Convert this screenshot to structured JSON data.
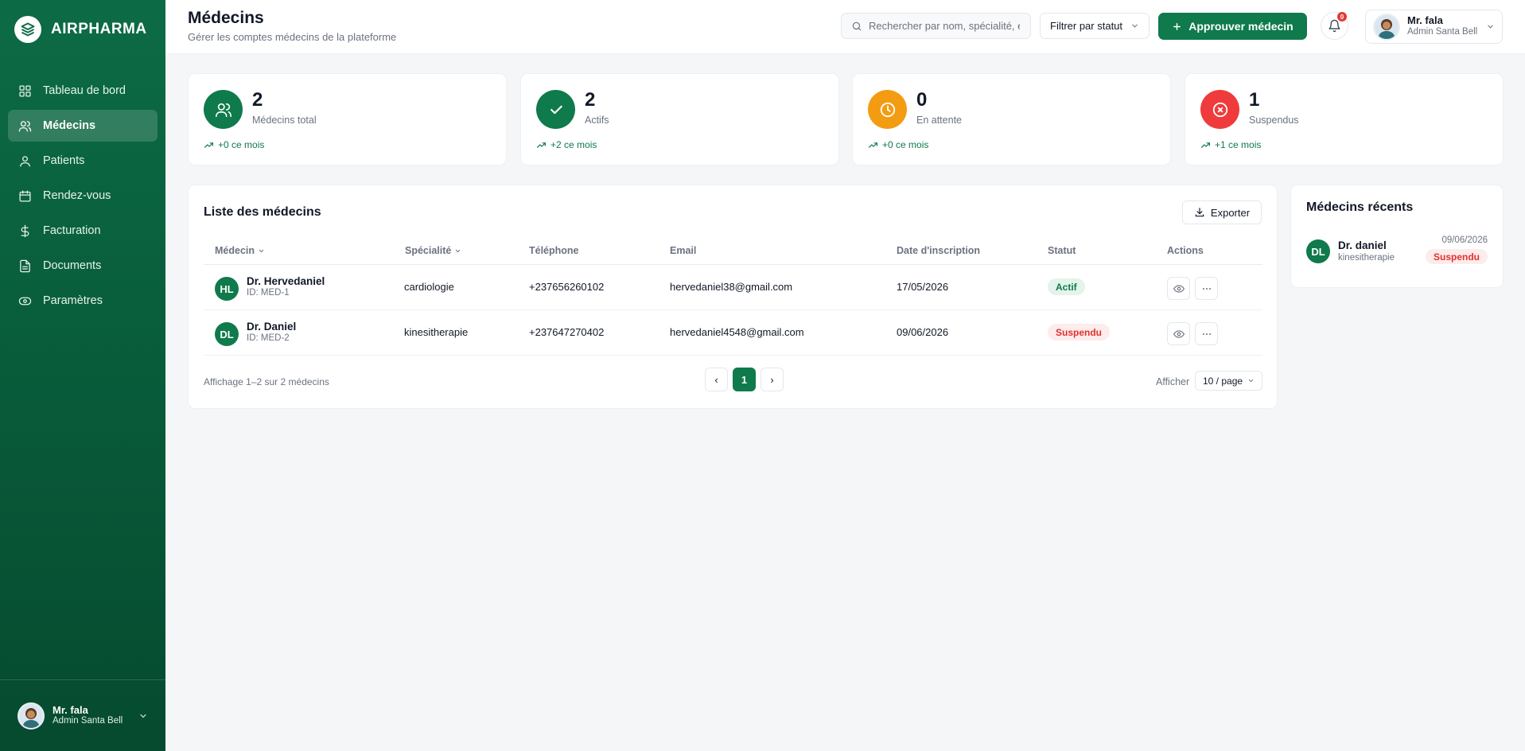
{
  "brand": {
    "name": "AIRPHARMA"
  },
  "sidebar": {
    "items": [
      {
        "label": "Tableau de bord",
        "icon": "grid-icon"
      },
      {
        "label": "Médecins",
        "icon": "users-icon",
        "active": true
      },
      {
        "label": "Patients",
        "icon": "user-icon"
      },
      {
        "label": "Rendez-vous",
        "icon": "calendar-icon"
      },
      {
        "label": "Facturation",
        "icon": "dollar-icon"
      },
      {
        "label": "Documents",
        "icon": "document-icon"
      },
      {
        "label": "Paramètres",
        "icon": "settings-icon"
      }
    ],
    "user": {
      "name": "Mr. fala",
      "role": "Admin Santa Bell"
    }
  },
  "header": {
    "title": "Médecins",
    "subtitle": "Gérer les comptes médecins de la plateforme",
    "search_placeholder": "Rechercher par nom, spécialité, email...",
    "filter_label": "Filtrer par statut",
    "approve_label": "Approuver médecin",
    "notifications_count": "0",
    "user": {
      "name": "Mr. fala",
      "role": "Admin Santa Bell"
    }
  },
  "stats": [
    {
      "value": "2",
      "label": "Médecins total",
      "trend": "+0 ce mois",
      "color": "#0f7a4b",
      "icon": "users-icon"
    },
    {
      "value": "2",
      "label": "Actifs",
      "trend": "+2 ce mois",
      "color": "#0f7a4b",
      "icon": "check-icon"
    },
    {
      "value": "0",
      "label": "En attente",
      "trend": "+0 ce mois",
      "color": "#f39c12",
      "icon": "clock-icon"
    },
    {
      "value": "1",
      "label": "Suspendus",
      "trend": "+1 ce mois",
      "color": "#ef3b3b",
      "icon": "x-circle-icon"
    }
  ],
  "table": {
    "title": "Liste des médecins",
    "export_label": "Exporter",
    "columns": [
      "Médecin",
      "Spécialité",
      "Téléphone",
      "Email",
      "Date d'inscription",
      "Statut",
      "Actions"
    ],
    "rows": [
      {
        "initials": "HL",
        "name": "Dr. Hervedaniel",
        "id": "ID: MED-1",
        "specialty": "cardiologie",
        "phone": "+237656260102",
        "email": "hervedaniel38@gmail.com",
        "date": "17/05/2026",
        "status": "Actif"
      },
      {
        "initials": "DL",
        "name": "Dr. Daniel",
        "id": "ID: MED-2",
        "specialty": "kinesitherapie",
        "phone": "+237647270402",
        "email": "hervedaniel4548@gmail.com",
        "date": "09/06/2026",
        "status": "Suspendu"
      }
    ],
    "footer_text": "Affichage 1–2 sur 2 médecins",
    "pagination": {
      "prev": "‹",
      "current": "1",
      "next": "›"
    },
    "per_page_label": "Afficher",
    "per_page_value": "10 / page"
  },
  "recent": {
    "title": "Médecins récents",
    "items": [
      {
        "initials": "DL",
        "name": "Dr. daniel",
        "specialty": "kinesitherapie",
        "date": "09/06/2026",
        "status": "Suspendu"
      }
    ]
  }
}
